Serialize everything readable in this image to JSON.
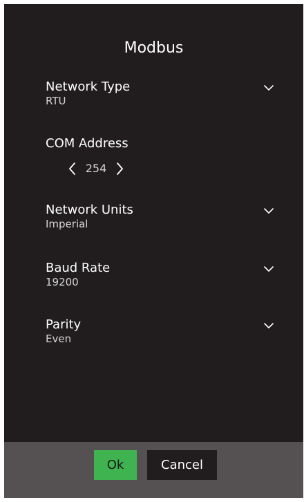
{
  "dialog": {
    "title": "Modbus"
  },
  "fields": {
    "network_type": {
      "label": "Network Type",
      "value": "RTU",
      "icon": "chevron-down-icon"
    },
    "com_address": {
      "label": "COM Address",
      "value": "254",
      "decrement_icon": "chevron-left-icon",
      "increment_icon": "chevron-right-icon"
    },
    "network_units": {
      "label": "Network Units",
      "value": "Imperial",
      "icon": "chevron-down-icon"
    },
    "baud_rate": {
      "label": "Baud Rate",
      "value": "19200",
      "icon": "chevron-down-icon"
    },
    "parity": {
      "label": "Parity",
      "value": "Even",
      "icon": "chevron-down-icon"
    }
  },
  "buttons": {
    "ok_label": "Ok",
    "cancel_label": "Cancel"
  },
  "colors": {
    "dialog_background": "#211d1e",
    "footer_background": "#555152",
    "ok_button": "#3fb34f",
    "text_primary": "#ffffff",
    "text_secondary": "#d6d6d6"
  }
}
